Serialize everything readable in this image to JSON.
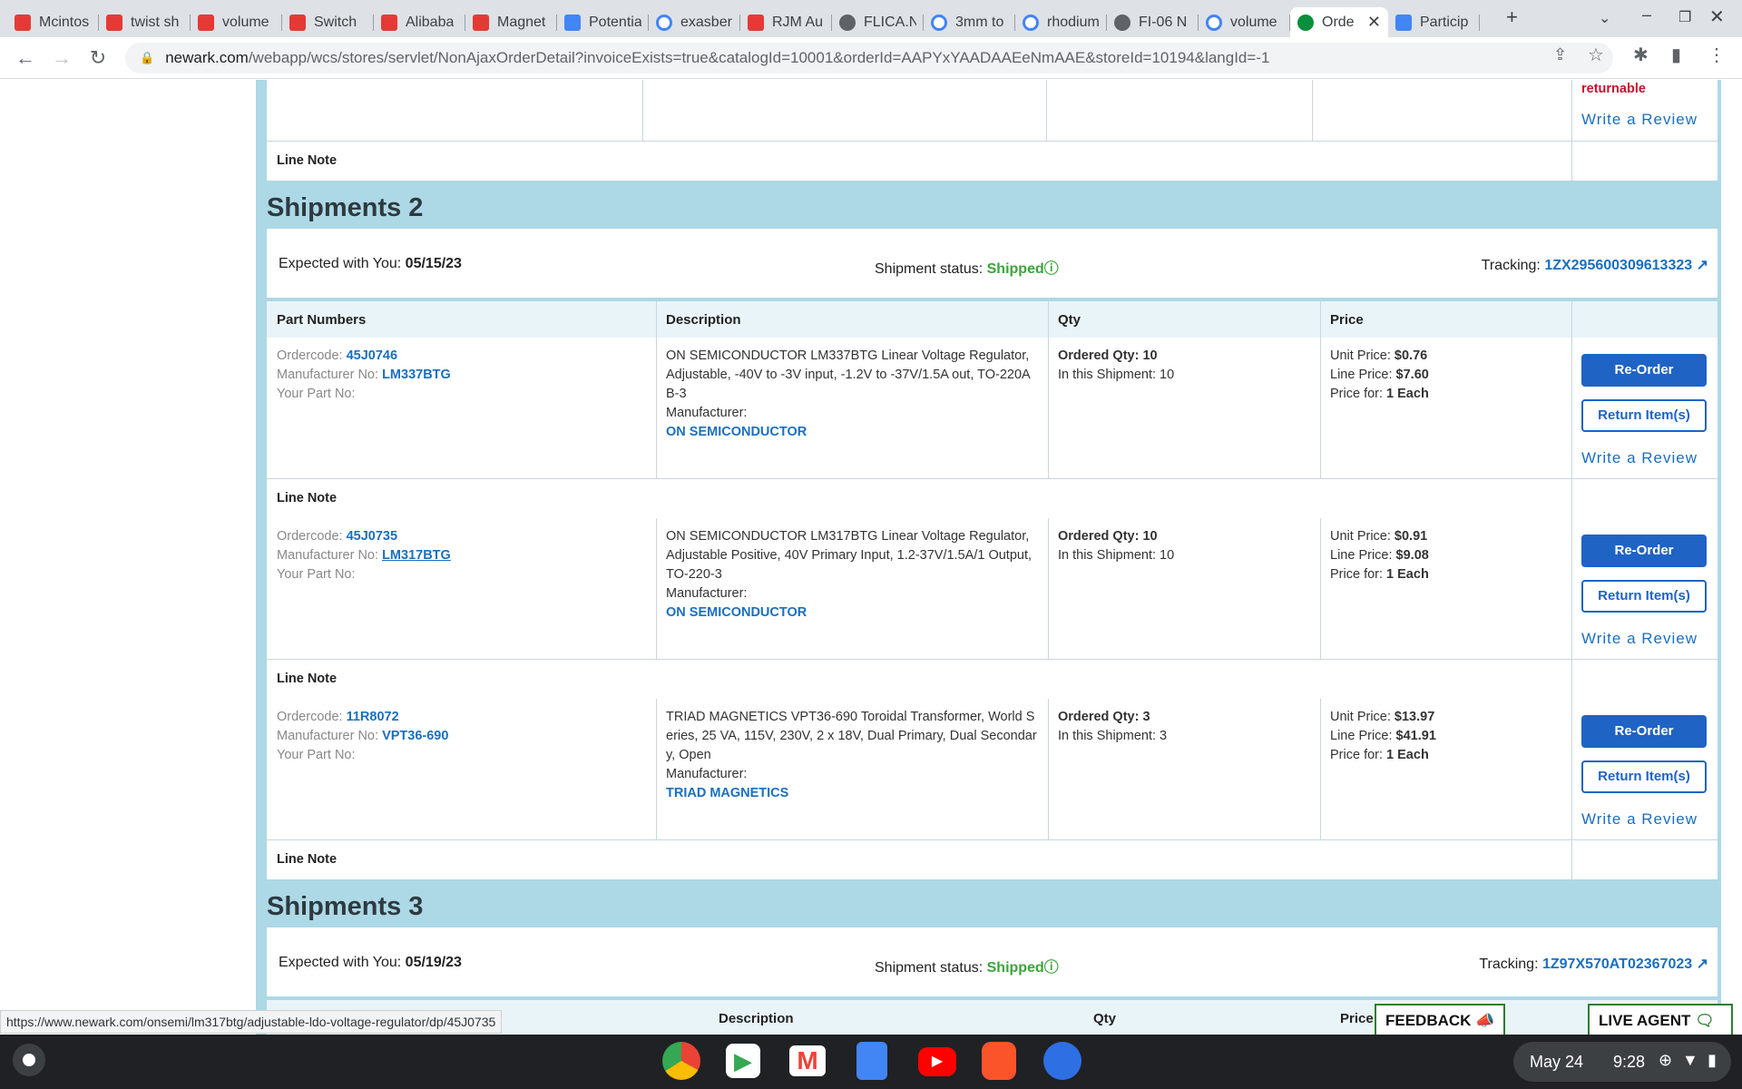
{
  "browser": {
    "tabs": [
      {
        "title": "Mcintos",
        "icon": "red"
      },
      {
        "title": "twist sh",
        "icon": "red"
      },
      {
        "title": "volume",
        "icon": "red"
      },
      {
        "title": "Switch",
        "icon": "red"
      },
      {
        "title": "Alibaba",
        "icon": "red"
      },
      {
        "title": "Magnet",
        "icon": "red"
      },
      {
        "title": "Potentia",
        "icon": "blue"
      },
      {
        "title": "exasber",
        "icon": "g"
      },
      {
        "title": "RJM Au",
        "icon": "red"
      },
      {
        "title": "FLICA.N",
        "icon": "dark"
      },
      {
        "title": "3mm to",
        "icon": "g"
      },
      {
        "title": "rhodium",
        "icon": "g"
      },
      {
        "title": "FI-06 N",
        "icon": "dark"
      },
      {
        "title": "volume",
        "icon": "g"
      },
      {
        "title": "Orde",
        "icon": "green",
        "active": true
      },
      {
        "title": "Particip",
        "icon": "blue"
      }
    ],
    "url_host": "newark.com",
    "url_path": "/webapp/wcs/stores/servlet/NonAjaxOrderDetail?invoiceExists=true&catalogId=10001&orderId=AAPYxYAADAAEeNmAAE&storeId=10194&langId=-1",
    "status_url": "https://www.newark.com/onsemi/lm317btg/adjustable-ldo-voltage-regulator/dp/45J0735"
  },
  "top_partial": {
    "returnable": "returnable",
    "review": "Write a Review",
    "line_note": "Line Note"
  },
  "shipments": [
    {
      "heading": "Shipments 2",
      "expected_label": "Expected with You:",
      "expected": "05/15/23",
      "status_label": "Shipment status:",
      "status": "Shipped",
      "tracking_label": "Tracking:",
      "tracking": "1ZX295600309613323",
      "headers": {
        "part": "Part Numbers",
        "desc": "Description",
        "qty": "Qty",
        "price": "Price"
      },
      "items": [
        {
          "ordercode_label": "Ordercode:",
          "ordercode": "45J0746",
          "mfr_label": "Manufacturer No:",
          "mfr_no": "LM337BTG",
          "your_part": "Your Part No:",
          "desc": "ON SEMICONDUCTOR  LM337BTG  Linear Voltage Regulator, Adjustable, -40V to -3V input, -1.2V to -37V/1.5A out, TO-220AB-3",
          "manufacturer_label": "Manufacturer:",
          "manufacturer": "ON SEMICONDUCTOR",
          "ordered_label": "Ordered Qty: 10",
          "shipment_qty": "In this Shipment: 10",
          "unit_label": "Unit Price:",
          "unit": "$0.76",
          "line_label": "Line Price:",
          "line": "$7.60",
          "pricefor_label": "Price for:",
          "pricefor": "1 Each",
          "reorder": "Re-Order",
          "return": "Return Item(s)",
          "review": "Write a Review",
          "line_note": "Line Note"
        },
        {
          "ordercode_label": "Ordercode:",
          "ordercode": "45J0735",
          "mfr_label": "Manufacturer No:",
          "mfr_no": "LM317BTG",
          "your_part": "Your Part No:",
          "desc": "ON SEMICONDUCTOR  LM317BTG  Linear Voltage Regulator, Adjustable Positive, 40V Primary Input, 1.2-37V/1.5A/1 Output, TO-220-3",
          "manufacturer_label": "Manufacturer:",
          "manufacturer": "ON SEMICONDUCTOR",
          "ordered_label": "Ordered Qty: 10",
          "shipment_qty": "In this Shipment: 10",
          "unit_label": "Unit Price:",
          "unit": "$0.91",
          "line_label": "Line Price:",
          "line": "$9.08",
          "pricefor_label": "Price for:",
          "pricefor": "1 Each",
          "reorder": "Re-Order",
          "return": "Return Item(s)",
          "review": "Write a Review",
          "line_note": "Line Note"
        },
        {
          "ordercode_label": "Ordercode:",
          "ordercode": "11R8072",
          "mfr_label": "Manufacturer No:",
          "mfr_no": "VPT36-690",
          "your_part": "Your Part No:",
          "desc": "TRIAD MAGNETICS  VPT36-690  Toroidal Transformer, World Series, 25 VA, 115V, 230V, 2 x 18V, Dual Primary, Dual Secondary, Open",
          "manufacturer_label": "Manufacturer:",
          "manufacturer": "TRIAD MAGNETICS",
          "ordered_label": "Ordered Qty: 3",
          "shipment_qty": "In this Shipment: 3",
          "unit_label": "Unit Price:",
          "unit": "$13.97",
          "line_label": "Line Price:",
          "line": "$41.91",
          "pricefor_label": "Price for:",
          "pricefor": "1 Each",
          "reorder": "Re-Order",
          "return": "Return Item(s)",
          "review": "Write a Review",
          "line_note": "Line Note"
        }
      ]
    },
    {
      "heading": "Shipments 3",
      "expected_label": "Expected with You:",
      "expected": "05/19/23",
      "status_label": "Shipment status:",
      "status": "Shipped",
      "tracking_label": "Tracking:",
      "tracking": "1Z97X570AT02367023",
      "headers": {
        "desc": "Description",
        "qty": "Qty",
        "price": "Price"
      }
    }
  ],
  "floating": {
    "feedback": "FEEDBACK",
    "live_agent": "LIVE AGENT"
  },
  "shelf": {
    "date": "May 24",
    "time": "9:28"
  }
}
